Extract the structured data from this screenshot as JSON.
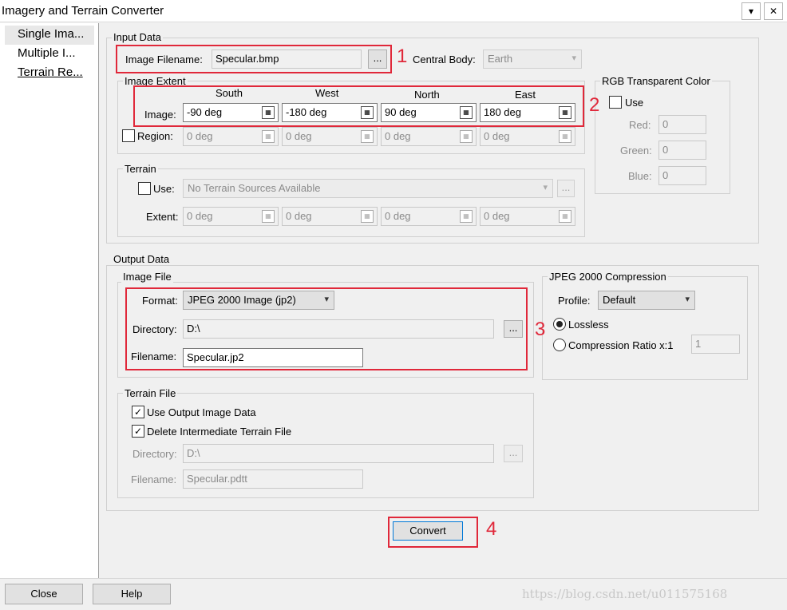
{
  "window": {
    "title": "Imagery and Terrain Converter",
    "dropdown_glyph": "▾",
    "close_glyph": "✕"
  },
  "tree": {
    "items": [
      {
        "label": "Single Ima..."
      },
      {
        "label": "Multiple I..."
      },
      {
        "label": "Terrain Re..."
      }
    ]
  },
  "input_data": {
    "group_label": "Input Data",
    "image_filename_label": "Image Filename:",
    "image_filename_value": "Specular.bmp",
    "browse_label": "...",
    "central_body_label": "Central Body:",
    "central_body_value": "Earth"
  },
  "image_extent": {
    "group_label": "Image Extent",
    "columns": [
      "South",
      "West",
      "North",
      "East"
    ],
    "image_label": "Image:",
    "image_values": [
      "-90 deg",
      "-180 deg",
      "90 deg",
      "180 deg"
    ],
    "region_label": "Region:",
    "region_values": [
      "0 deg",
      "0 deg",
      "0 deg",
      "0 deg"
    ]
  },
  "rgb": {
    "group_label": "RGB Transparent Color",
    "use_label": "Use",
    "red_label": "Red:",
    "red_value": "0",
    "green_label": "Green:",
    "green_value": "0",
    "blue_label": "Blue:",
    "blue_value": "0"
  },
  "terrain": {
    "group_label": "Terrain",
    "use_label": "Use:",
    "source_value": "No Terrain Sources Available",
    "browse_label": "...",
    "extent_label": "Extent:",
    "extent_values": [
      "0 deg",
      "0 deg",
      "0 deg",
      "0 deg"
    ]
  },
  "output_data": {
    "group_label": "Output Data",
    "image_file": {
      "group_label": "Image File",
      "format_label": "Format:",
      "format_value": "JPEG 2000 Image (jp2)",
      "directory_label": "Directory:",
      "directory_value": "D:\\",
      "browse_label": "...",
      "filename_label": "Filename:",
      "filename_value": "Specular.jp2"
    },
    "jpeg2000": {
      "group_label": "JPEG 2000 Compression",
      "profile_label": "Profile:",
      "profile_value": "Default",
      "lossless_label": "Lossless",
      "ratio_label": "Compression Ratio x:1",
      "ratio_value": "1"
    },
    "terrain_file": {
      "group_label": "Terrain File",
      "use_output_label": "Use Output Image Data",
      "delete_label": "Delete Intermediate Terrain File",
      "directory_label": "Directory:",
      "directory_value": "D:\\",
      "browse_label": "...",
      "filename_label": "Filename:",
      "filename_value": "Specular.pdtt"
    }
  },
  "convert_label": "Convert",
  "annotations": [
    "1",
    "2",
    "3",
    "4"
  ],
  "bottom": {
    "close_label": "Close",
    "help_label": "Help"
  },
  "watermark": "https://blog.csdn.net/u011575168",
  "colors": {
    "annotation": "#e0283a",
    "focus": "#0078d7"
  }
}
